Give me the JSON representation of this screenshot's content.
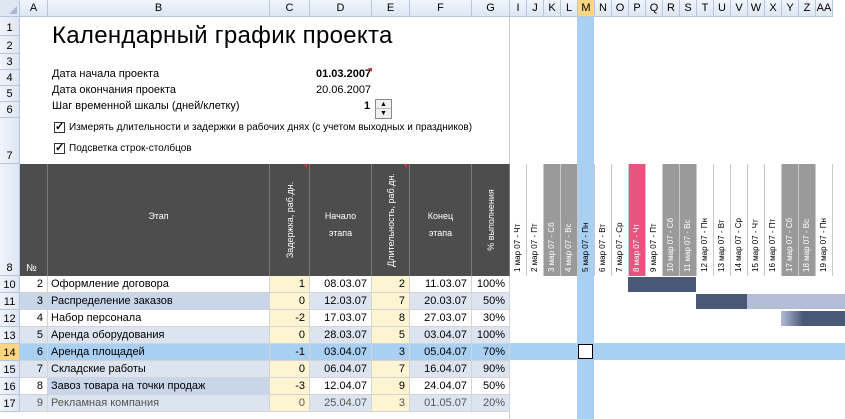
{
  "columns": [
    "A",
    "B",
    "C",
    "D",
    "E",
    "F",
    "G",
    "I",
    "J",
    "K",
    "L",
    "M",
    "N",
    "O",
    "P",
    "Q",
    "R",
    "S",
    "T",
    "U",
    "V",
    "W",
    "X",
    "Y",
    "Z",
    "AA"
  ],
  "selected_column": "M",
  "rows": [
    "1",
    "2",
    "3",
    "4",
    "5",
    "6",
    "7",
    "8",
    "10",
    "11",
    "12",
    "13",
    "14",
    "15",
    "16",
    "17"
  ],
  "selected_row": "14",
  "title": "Календарный график проекта",
  "params": {
    "start_label": "Дата начала проекта",
    "start_value": "01.03.2007",
    "end_label": "Дата окончания проекта",
    "end_value": "20.06.2007",
    "step_label": "Шаг временной шкалы (дней/клетку)",
    "step_value": "1"
  },
  "checkboxes": {
    "workdays": "Измерять длительности и задержки в рабочих днях (с учетом выходных и праздников)",
    "highlight": "Подсветка строк-столбцов"
  },
  "table_header": {
    "num": "№",
    "stage": "Этап",
    "delay": "Задержка, раб.дн.",
    "start": "Начало этапа",
    "duration": "Длительность, раб.дн.",
    "end": "Конец этапа",
    "percent": "% выполнения"
  },
  "dates": [
    "1 мар 07 - Чт",
    "2 мар 07 - Пт",
    "3 мар 07 - Сб",
    "4 мар 07 - Вс",
    "5 мар 07 - Пн",
    "6 мар 07 - Вт",
    "7 мар 07 - Ср",
    "8 мар 07 - Чт",
    "9 мар 07 - Пт",
    "10 мар 07 - Сб",
    "11 мар 07 - Вс",
    "12 мар 07 - Пн",
    "13 мар 07 - Вт",
    "14 мар 07 - Ср",
    "15 мар 07 - Чт",
    "16 мар 07 - Пт",
    "17 мар 07 - Сб",
    "18 мар 07 - Вс",
    "19 мар 07 - Пн"
  ],
  "tasks": [
    {
      "num": "2",
      "name": "Оформление договора",
      "delay": "1",
      "start": "08.03.07",
      "duration": "2",
      "end": "11.03.07",
      "percent": "100%"
    },
    {
      "num": "3",
      "name": "Распределение заказов",
      "delay": "0",
      "start": "12.03.07",
      "duration": "7",
      "end": "20.03.07",
      "percent": "50%"
    },
    {
      "num": "4",
      "name": "Набор персонала",
      "delay": "-2",
      "start": "17.03.07",
      "duration": "8",
      "end": "27.03.07",
      "percent": "30%"
    },
    {
      "num": "5",
      "name": "Аренда оборудования",
      "delay": "0",
      "start": "28.03.07",
      "duration": "5",
      "end": "03.04.07",
      "percent": "100%"
    },
    {
      "num": "6",
      "name": "Аренда площадей",
      "delay": "-1",
      "start": "03.04.07",
      "duration": "3",
      "end": "05.04.07",
      "percent": "70%"
    },
    {
      "num": "7",
      "name": "Складские работы",
      "delay": "0",
      "start": "06.04.07",
      "duration": "7",
      "end": "16.04.07",
      "percent": "90%"
    },
    {
      "num": "8",
      "name": "Завоз товара на точки продаж",
      "delay": "-3",
      "start": "12.04.07",
      "duration": "9",
      "end": "24.04.07",
      "percent": "50%"
    },
    {
      "num": "9",
      "name": "Рекламная компания",
      "delay": "0",
      "start": "25.04.07",
      "duration": "3",
      "end": "01.05.07",
      "percent": "20%"
    }
  ],
  "colors": {
    "header_dark": "#4d4d4d",
    "today": "#e75480",
    "highlight": "#a9cff2",
    "bar_done": "#4a5878",
    "bar_todo": "#b3bdd6"
  }
}
